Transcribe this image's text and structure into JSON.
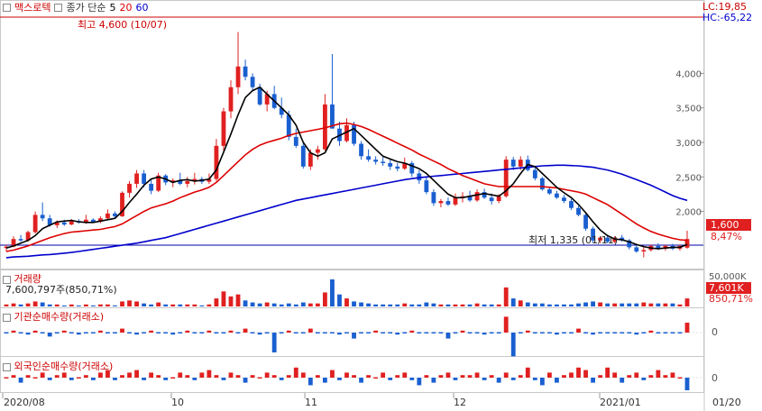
{
  "header": {
    "stock_name": "맥스로텍",
    "ma_label": "종가 단순",
    "ma_periods": [
      "5",
      "20",
      "60"
    ],
    "lc": "LC:19,85",
    "hc": "HC:-65,22"
  },
  "annotations": {
    "high": "최고 4,600 (10/07)",
    "low": "최저 1,335 (01/11)"
  },
  "price_badge": {
    "value": "1,600",
    "change": "8,47%"
  },
  "volume_panel": {
    "title": "거래량",
    "value": "7,600,797주(850,71%)",
    "axis_top": "50,000K",
    "badge": "7,601K",
    "badge_pct": "850,71%"
  },
  "inst_panel": {
    "title": "기관순매수량(거래소)",
    "axis_zero": "0"
  },
  "foreign_panel": {
    "title": "외국인순매수량(거래소)",
    "axis_zero": "0"
  },
  "x_axis": [
    "2020/08",
    "10",
    "11",
    "12",
    "2021/01",
    "01/20"
  ],
  "y_axis": [
    "4,000",
    "3,500",
    "3,000",
    "2,500",
    "2,000"
  ],
  "colors": {
    "up": "#e02020",
    "down": "#1a5fd0",
    "ma5": "#000000",
    "ma20": "#dd0000",
    "ma60": "#0000cc"
  },
  "chart_data": {
    "type": "candlestick",
    "y_range": [
      1250,
      4750
    ],
    "ohlc": [
      [
        1470,
        1520,
        1420,
        1490
      ],
      [
        1490,
        1640,
        1480,
        1600
      ],
      [
        1600,
        1660,
        1560,
        1580
      ],
      [
        1580,
        1720,
        1560,
        1700
      ],
      [
        1700,
        2000,
        1680,
        1950
      ],
      [
        1950,
        2130,
        1860,
        1900
      ],
      [
        1900,
        1950,
        1780,
        1800
      ],
      [
        1800,
        1870,
        1760,
        1840
      ],
      [
        1840,
        1880,
        1790,
        1810
      ],
      [
        1810,
        1890,
        1800,
        1860
      ],
      [
        1860,
        1890,
        1820,
        1840
      ],
      [
        1840,
        1950,
        1820,
        1880
      ],
      [
        1880,
        1900,
        1840,
        1850
      ],
      [
        1850,
        1930,
        1830,
        1900
      ],
      [
        1900,
        2030,
        1880,
        1970
      ],
      [
        1970,
        2000,
        1890,
        1930
      ],
      [
        1930,
        2290,
        1920,
        2270
      ],
      [
        2270,
        2440,
        2200,
        2400
      ],
      [
        2400,
        2600,
        2340,
        2550
      ],
      [
        2550,
        2600,
        2350,
        2400
      ],
      [
        2400,
        2480,
        2250,
        2300
      ],
      [
        2300,
        2560,
        2280,
        2520
      ],
      [
        2520,
        2540,
        2380,
        2420
      ],
      [
        2420,
        2480,
        2350,
        2450
      ],
      [
        2450,
        2560,
        2380,
        2400
      ],
      [
        2400,
        2500,
        2350,
        2440
      ],
      [
        2440,
        2560,
        2390,
        2470
      ],
      [
        2470,
        2500,
        2400,
        2430
      ],
      [
        2430,
        2550,
        2400,
        2470
      ],
      [
        2470,
        3050,
        2440,
        2950
      ],
      [
        2950,
        3500,
        2880,
        3450
      ],
      [
        3450,
        3900,
        3350,
        3800
      ],
      [
        3800,
        4600,
        3700,
        4100
      ],
      [
        4100,
        4200,
        3900,
        3950
      ],
      [
        3950,
        4000,
        3750,
        3800
      ],
      [
        3800,
        3850,
        3530,
        3550
      ],
      [
        3550,
        3750,
        3450,
        3700
      ],
      [
        3700,
        3820,
        3480,
        3500
      ],
      [
        3500,
        3650,
        3350,
        3400
      ],
      [
        3400,
        3460,
        3030,
        3080
      ],
      [
        3080,
        3200,
        2920,
        2950
      ],
      [
        2950,
        3000,
        2620,
        2650
      ],
      [
        2650,
        2900,
        2600,
        2850
      ],
      [
        2850,
        2950,
        2750,
        2900
      ],
      [
        2900,
        3700,
        2880,
        3550
      ],
      [
        3550,
        4280,
        3450,
        3200
      ],
      [
        3200,
        3300,
        2950,
        3020
      ],
      [
        3020,
        3350,
        3000,
        3250
      ],
      [
        3250,
        3300,
        2950,
        2980
      ],
      [
        2980,
        3020,
        2750,
        2800
      ],
      [
        2800,
        2900,
        2720,
        2750
      ],
      [
        2750,
        2800,
        2680,
        2720
      ],
      [
        2720,
        2790,
        2660,
        2700
      ],
      [
        2700,
        2750,
        2600,
        2650
      ],
      [
        2650,
        2700,
        2580,
        2620
      ],
      [
        2620,
        2780,
        2600,
        2700
      ],
      [
        2700,
        2730,
        2500,
        2550
      ],
      [
        2550,
        2600,
        2400,
        2450
      ],
      [
        2450,
        2500,
        2250,
        2280
      ],
      [
        2280,
        2320,
        2080,
        2120
      ],
      [
        2120,
        2180,
        2060,
        2150
      ],
      [
        2150,
        2200,
        2080,
        2100
      ],
      [
        2100,
        2260,
        2080,
        2200
      ],
      [
        2200,
        2280,
        2130,
        2220
      ],
      [
        2220,
        2300,
        2140,
        2160
      ],
      [
        2160,
        2320,
        2140,
        2280
      ],
      [
        2280,
        2330,
        2180,
        2200
      ],
      [
        2200,
        2260,
        2100,
        2150
      ],
      [
        2150,
        2250,
        2120,
        2220
      ],
      [
        2220,
        2800,
        2200,
        2750
      ],
      [
        2750,
        2790,
        2600,
        2650
      ],
      [
        2650,
        2800,
        2600,
        2750
      ],
      [
        2750,
        2810,
        2580,
        2600
      ],
      [
        2600,
        2650,
        2450,
        2480
      ],
      [
        2480,
        2500,
        2300,
        2320
      ],
      [
        2320,
        2350,
        2240,
        2260
      ],
      [
        2260,
        2300,
        2180,
        2200
      ],
      [
        2200,
        2240,
        2120,
        2150
      ],
      [
        2150,
        2180,
        2020,
        2050
      ],
      [
        2050,
        2080,
        1930,
        1950
      ],
      [
        1950,
        1980,
        1720,
        1750
      ],
      [
        1750,
        1780,
        1550,
        1580
      ],
      [
        1580,
        1640,
        1540,
        1620
      ],
      [
        1620,
        1660,
        1540,
        1560
      ],
      [
        1560,
        1640,
        1540,
        1620
      ],
      [
        1620,
        1660,
        1560,
        1580
      ],
      [
        1580,
        1600,
        1450,
        1480
      ],
      [
        1480,
        1520,
        1400,
        1420
      ],
      [
        1420,
        1500,
        1335,
        1440
      ],
      [
        1440,
        1520,
        1420,
        1500
      ],
      [
        1500,
        1540,
        1440,
        1460
      ],
      [
        1460,
        1520,
        1430,
        1500
      ],
      [
        1500,
        1530,
        1440,
        1460
      ],
      [
        1460,
        1520,
        1430,
        1500
      ],
      [
        1475,
        1720,
        1460,
        1600
      ]
    ],
    "ma5": [
      1470,
      1500,
      1540,
      1580,
      1650,
      1750,
      1800,
      1850,
      1860,
      1870,
      1850,
      1840,
      1840,
      1860,
      1880,
      1900,
      2000,
      2130,
      2250,
      2380,
      2470,
      2500,
      2470,
      2420,
      2450,
      2460,
      2440,
      2450,
      2470,
      2600,
      2860,
      3120,
      3400,
      3650,
      3750,
      3800,
      3700,
      3600,
      3500,
      3400,
      3250,
      3000,
      2850,
      2800,
      2850,
      3050,
      3100,
      3150,
      3200,
      3100,
      3000,
      2900,
      2800,
      2760,
      2720,
      2700,
      2660,
      2620,
      2550,
      2450,
      2350,
      2250,
      2200,
      2200,
      2220,
      2240,
      2260,
      2240,
      2220,
      2300,
      2400,
      2550,
      2680,
      2650,
      2550,
      2450,
      2350,
      2270,
      2200,
      2100,
      1980,
      1850,
      1730,
      1650,
      1600,
      1590,
      1560,
      1520,
      1490,
      1470,
      1460,
      1470,
      1480,
      1480,
      1520
    ],
    "ma20": [
      1420,
      1440,
      1470,
      1500,
      1540,
      1580,
      1620,
      1650,
      1680,
      1700,
      1710,
      1720,
      1730,
      1740,
      1760,
      1780,
      1820,
      1880,
      1940,
      2000,
      2050,
      2080,
      2110,
      2150,
      2200,
      2240,
      2280,
      2310,
      2350,
      2420,
      2520,
      2620,
      2720,
      2820,
      2900,
      2960,
      3000,
      3030,
      3060,
      3100,
      3130,
      3150,
      3170,
      3190,
      3210,
      3240,
      3270,
      3280,
      3260,
      3230,
      3190,
      3140,
      3090,
      3040,
      2990,
      2940,
      2890,
      2830,
      2780,
      2730,
      2680,
      2620,
      2570,
      2520,
      2480,
      2440,
      2400,
      2380,
      2360,
      2360,
      2360,
      2360,
      2360,
      2360,
      2360,
      2350,
      2340,
      2320,
      2300,
      2280,
      2250,
      2200,
      2150,
      2100,
      2030,
      1960,
      1890,
      1820,
      1760,
      1710,
      1670,
      1640,
      1610,
      1590,
      1580
    ],
    "ma60": [
      1330,
      1340,
      1345,
      1350,
      1360,
      1370,
      1375,
      1385,
      1395,
      1405,
      1420,
      1435,
      1450,
      1465,
      1480,
      1495,
      1510,
      1525,
      1540,
      1560,
      1580,
      1600,
      1620,
      1650,
      1680,
      1710,
      1740,
      1770,
      1800,
      1830,
      1860,
      1890,
      1920,
      1950,
      1980,
      2010,
      2040,
      2070,
      2100,
      2130,
      2160,
      2180,
      2200,
      2220,
      2240,
      2260,
      2280,
      2300,
      2320,
      2340,
      2360,
      2380,
      2400,
      2420,
      2440,
      2460,
      2475,
      2490,
      2500,
      2510,
      2520,
      2530,
      2540,
      2550,
      2560,
      2570,
      2580,
      2590,
      2600,
      2610,
      2620,
      2630,
      2640,
      2650,
      2660,
      2665,
      2670,
      2670,
      2665,
      2660,
      2650,
      2640,
      2620,
      2600,
      2570,
      2540,
      2500,
      2460,
      2420,
      2380,
      2330,
      2280,
      2230,
      2190,
      2160
    ],
    "volume": [
      2,
      3,
      2,
      3,
      5,
      4,
      2,
      2,
      1,
      2,
      1,
      2,
      1,
      2,
      2,
      1,
      5,
      6,
      5,
      3,
      2,
      4,
      2,
      2,
      2,
      2,
      2,
      1,
      2,
      8,
      15,
      10,
      12,
      6,
      4,
      3,
      4,
      3,
      2,
      3,
      2,
      4,
      3,
      3,
      14,
      27,
      12,
      8,
      5,
      4,
      3,
      2,
      2,
      2,
      2,
      3,
      2,
      2,
      4,
      3,
      2,
      2,
      2,
      2,
      2,
      3,
      2,
      2,
      2,
      19,
      8,
      6,
      4,
      3,
      3,
      2,
      2,
      2,
      2,
      3,
      4,
      5,
      4,
      3,
      3,
      3,
      3,
      3,
      4,
      3,
      3,
      3,
      3,
      2,
      8
    ],
    "institutional": [
      0,
      1,
      0,
      -1,
      1,
      0,
      -2,
      0,
      1,
      0,
      -1,
      0,
      0,
      1,
      0,
      0,
      2,
      0,
      -1,
      0,
      1,
      0,
      0,
      -1,
      0,
      1,
      0,
      0,
      1,
      0,
      0,
      1,
      0,
      2,
      0,
      -1,
      0,
      -10,
      0,
      1,
      0,
      0,
      2,
      0,
      0,
      0,
      -1,
      0,
      -3,
      0,
      0,
      1,
      0,
      0,
      -1,
      0,
      1,
      0,
      0,
      0,
      0,
      -3,
      0,
      1,
      0,
      0,
      -1,
      0,
      0,
      8,
      -12,
      0,
      1,
      0,
      0,
      0,
      -1,
      0,
      0,
      2,
      0,
      -1,
      0,
      0,
      0,
      0,
      0,
      -1,
      0,
      1,
      0,
      0,
      0,
      0,
      5
    ],
    "foreign": [
      0,
      1,
      -2,
      1,
      0,
      2,
      -1,
      1,
      2,
      -1,
      0,
      1,
      -1,
      2,
      3,
      -1,
      1,
      2,
      3,
      -1,
      2,
      1,
      -1,
      0,
      2,
      1,
      -1,
      2,
      3,
      1,
      -1,
      2,
      1,
      -2,
      1,
      0,
      2,
      1,
      -1,
      1,
      4,
      2,
      -3,
      1,
      -2,
      3,
      -1,
      2,
      1,
      -2,
      1,
      0,
      2,
      -1,
      1,
      2,
      -1,
      -3,
      1,
      -2,
      1,
      2,
      -1,
      1,
      1,
      2,
      -1,
      1,
      -2,
      2,
      -1,
      1,
      4,
      -1,
      -3,
      2,
      -2,
      1,
      2,
      4,
      3,
      -2,
      1,
      4,
      2,
      -2,
      1,
      2,
      -1,
      1,
      3,
      1,
      2,
      0,
      -5
    ]
  }
}
